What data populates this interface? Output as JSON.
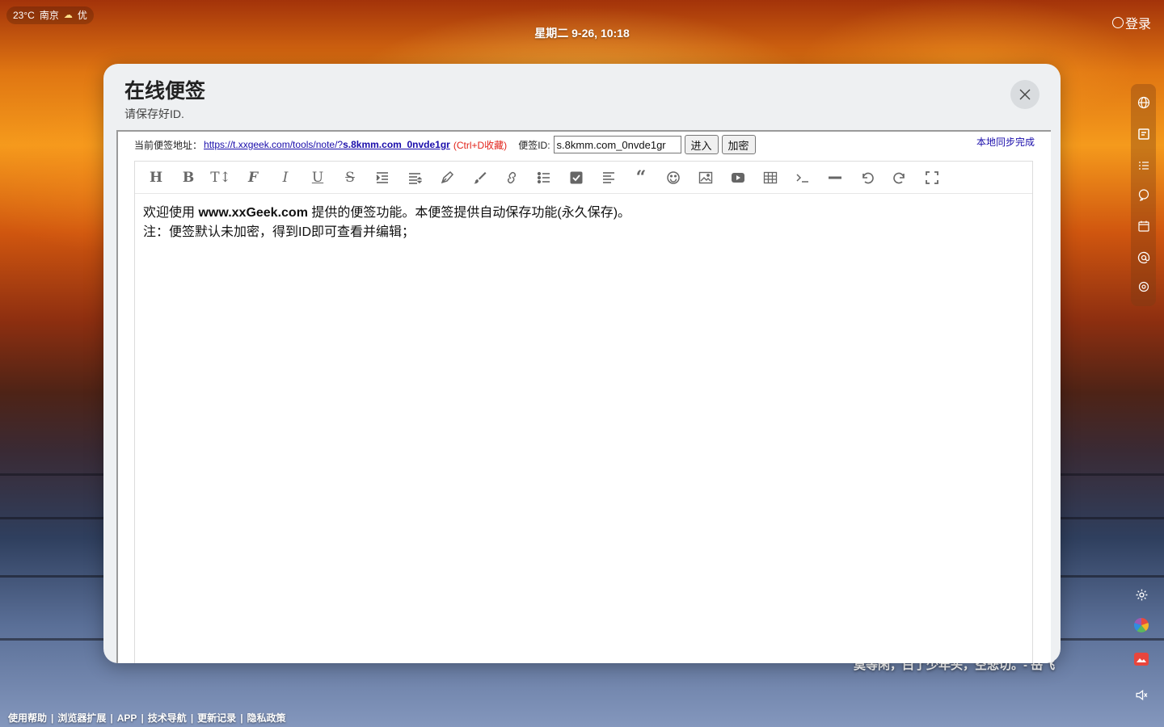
{
  "weather": {
    "temp": "23°C",
    "city": "南京",
    "icon": "partly-cloudy-icon",
    "aqi": "优"
  },
  "clock": "星期二 9-26, 10:18",
  "login_label": "登录",
  "quote": "莫等闲，白了少年头，空悲切。- 岳飞",
  "footer": [
    "使用帮助",
    "浏览器扩展",
    "APP",
    "技术导航",
    "更新记录",
    "隐私政策"
  ],
  "dock": [
    "globe-icon",
    "note-icon",
    "checklist-icon",
    "chat-icon",
    "calendar-icon",
    "at-icon",
    "chatgpt-icon"
  ],
  "side_tools": [
    "gear-icon",
    "color-wheel-icon",
    "wallpaper-icon",
    "speaker-icon"
  ],
  "modal": {
    "title": "在线便签",
    "subtitle": "请保存好ID.",
    "addr_label": "当前便签地址：",
    "addr_url_prefix": "https://t.xxgeek.com/tools/note/?",
    "addr_url_id": "s.8kmm.com_0nvde1gr",
    "addr_hint": "(Ctrl+D收藏)",
    "id_label": "便签ID:",
    "id_value": "s.8kmm.com_0nvde1gr",
    "enter_btn": "进入",
    "encrypt_btn": "加密",
    "sync_status": "本地同步完成",
    "toolbar": [
      "heading-icon",
      "bold-icon",
      "font-size-icon",
      "font-family-icon",
      "italic-icon",
      "underline-icon",
      "strikethrough-icon",
      "indent-icon",
      "line-height-icon",
      "pen-icon",
      "brush-icon",
      "link-icon",
      "bullet-list-icon",
      "checkbox-icon",
      "align-left-icon",
      "quote-icon",
      "emoji-icon",
      "image-icon",
      "video-icon",
      "table-icon",
      "code-icon",
      "hr-icon",
      "undo-icon",
      "redo-icon",
      "fullscreen-icon"
    ],
    "content": {
      "line1_pre": "欢迎使用 ",
      "line1_bold": "www.xxGeek.com",
      "line1_post": " 提供的便签功能。本便签提供自动保存功能(永久保存)。",
      "line2": "注：便签默认未加密，得到ID即可查看并编辑；"
    }
  },
  "colors": {
    "link": "#1a0dab",
    "hint": "#e2231a",
    "modal_bg": "#eef0f2"
  }
}
